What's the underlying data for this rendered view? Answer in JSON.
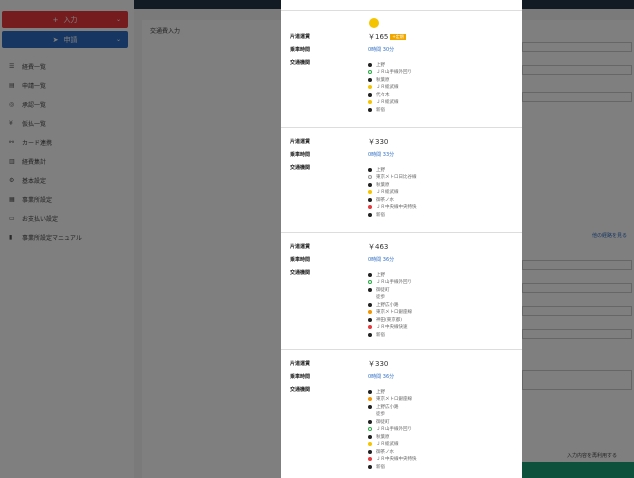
{
  "sidebar": {
    "input_label": "入力",
    "request_label": "申請",
    "items": [
      {
        "label": "経費一覧",
        "icon": "list-icon"
      },
      {
        "label": "申請一覧",
        "icon": "bar-chart-icon"
      },
      {
        "label": "承認一覧",
        "icon": "approve-icon"
      },
      {
        "label": "仮払一覧",
        "icon": "yen-circle-icon"
      },
      {
        "label": "カード連携",
        "icon": "link-icon"
      },
      {
        "label": "経費集計",
        "icon": "chart-icon"
      },
      {
        "label": "基本設定",
        "icon": "gear-icon"
      },
      {
        "label": "事業所設定",
        "icon": "building-icon"
      },
      {
        "label": "お支払い設定",
        "icon": "card-icon"
      },
      {
        "label": "事業所設定マニュアル",
        "icon": "book-icon"
      }
    ]
  },
  "main": {
    "title": "交通費入力",
    "other_route_link": "他の経路を見る",
    "reuse_label": "入力内容を再利用する",
    "accent": "#1aa37a"
  },
  "modal": {
    "labels": {
      "fare": "片道運賃",
      "duration": "乗車時間",
      "transport": "交通機関"
    },
    "routes": [
      {
        "fare": "￥165",
        "badge": "+定期",
        "duration": "0時間 30分",
        "stations": [
          {
            "name": "上野",
            "color": "black"
          },
          {
            "name": "ＪＲ山手線外回り",
            "color": "green"
          },
          {
            "name": "秋葉原",
            "color": "black"
          },
          {
            "name": "ＪＲ総武線",
            "color": "yellow"
          },
          {
            "name": "代々木",
            "color": "black"
          },
          {
            "name": "ＪＲ総武線",
            "color": "yellow"
          },
          {
            "name": "新宿",
            "color": "black"
          }
        ]
      },
      {
        "fare": "￥330",
        "badge": "",
        "duration": "0時間 33分",
        "stations": [
          {
            "name": "上野",
            "color": "black"
          },
          {
            "name": "東京メトロ日比谷線",
            "color": "gray"
          },
          {
            "name": "秋葉原",
            "color": "black"
          },
          {
            "name": "ＪＲ総武線",
            "color": "yellow"
          },
          {
            "name": "御茶ノ水",
            "color": "black"
          },
          {
            "name": "ＪＲ中央線中央特快",
            "color": "red"
          },
          {
            "name": "新宿",
            "color": "black"
          }
        ]
      },
      {
        "fare": "￥463",
        "badge": "",
        "duration": "0時間 36分",
        "stations": [
          {
            "name": "上野",
            "color": "black"
          },
          {
            "name": "ＪＲ山手線外回り",
            "color": "green"
          },
          {
            "name": "御徒町",
            "color": "black"
          },
          {
            "name": "徒歩",
            "color": "none"
          },
          {
            "name": "上野広小路",
            "color": "black"
          },
          {
            "name": "東京メトロ銀座線",
            "color": "orange"
          },
          {
            "name": "神田(東京都)",
            "color": "black"
          },
          {
            "name": "ＪＲ中央線快速",
            "color": "red"
          },
          {
            "name": "新宿",
            "color": "black"
          }
        ]
      },
      {
        "fare": "￥330",
        "badge": "",
        "duration": "0時間 36分",
        "stations": [
          {
            "name": "上野",
            "color": "black"
          },
          {
            "name": "東京メトロ銀座線",
            "color": "orange"
          },
          {
            "name": "上野広小路",
            "color": "black"
          },
          {
            "name": "徒歩",
            "color": "none"
          },
          {
            "name": "御徒町",
            "color": "black"
          },
          {
            "name": "ＪＲ山手線外回り",
            "color": "green"
          },
          {
            "name": "秋葉原",
            "color": "black"
          },
          {
            "name": "ＪＲ総武線",
            "color": "yellow"
          },
          {
            "name": "御茶ノ水",
            "color": "black"
          },
          {
            "name": "ＪＲ中央線中央特快",
            "color": "red"
          },
          {
            "name": "新宿",
            "color": "black"
          }
        ]
      }
    ]
  }
}
